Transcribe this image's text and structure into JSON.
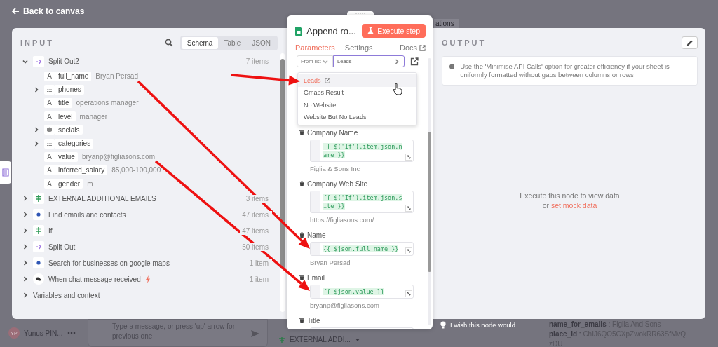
{
  "back_button": {
    "label": "Back to canvas"
  },
  "background": {
    "tab_fragment": "ations",
    "user": {
      "initials": "YP",
      "name": "Yunus PIN..."
    },
    "chat": {
      "placeholder": "Type a message, or press 'up' arrow for previous one"
    },
    "node_chip": {
      "label": "EXTERNAL ADDI..."
    },
    "fields": [
      {
        "key": "name_for_emails",
        "separator": ":",
        "value": "Figlia And Sons"
      },
      {
        "key": "place_id",
        "separator": ":",
        "value": "ChIJ6QO5CXpZwokRR63SfMvQzDU"
      }
    ]
  },
  "input": {
    "title": "INPUT",
    "view_tabs": [
      {
        "label": "Schema",
        "selected": true
      },
      {
        "label": "Table",
        "selected": false
      },
      {
        "label": "JSON",
        "selected": false
      }
    ],
    "nodes": [
      {
        "name": "Split Out2",
        "kind": "split",
        "count": "7 items",
        "expanded": true,
        "trigger": false,
        "fields": [
          {
            "kind": "string",
            "type_label": "A",
            "key": "full_name",
            "value": "Bryan Persad"
          },
          {
            "kind": "array",
            "key": "phones"
          },
          {
            "kind": "string",
            "type_label": "A",
            "key": "title",
            "value": "operations manager"
          },
          {
            "kind": "string",
            "type_label": "A",
            "key": "level",
            "value": "manager"
          },
          {
            "kind": "object",
            "key": "socials"
          },
          {
            "kind": "array",
            "key": "categories"
          },
          {
            "kind": "string",
            "type_label": "A",
            "key": "value",
            "value": "bryanp@figliasons.com"
          },
          {
            "kind": "string",
            "type_label": "A",
            "key": "inferred_salary",
            "value": "85,000-100,000"
          },
          {
            "kind": "string",
            "type_label": "A",
            "key": "gender",
            "value": "m"
          }
        ]
      },
      {
        "name": "EXTERNAL ADDITIONAL EMAILS",
        "kind": "if",
        "count": "3 items",
        "expanded": false,
        "trigger": false
      },
      {
        "name": "Find emails and contacts",
        "kind": "http",
        "count": "47 items",
        "expanded": false,
        "trigger": false
      },
      {
        "name": "If",
        "kind": "if",
        "count": "47 items",
        "expanded": false,
        "trigger": false
      },
      {
        "name": "Split Out",
        "kind": "split",
        "count": "50 items",
        "expanded": false,
        "trigger": false
      },
      {
        "name": "Search for businesses on google maps",
        "kind": "http",
        "count": "1 item",
        "expanded": false,
        "trigger": false
      },
      {
        "name": "When chat message received",
        "kind": "chat",
        "count": "1 item",
        "expanded": false,
        "trigger": true
      }
    ],
    "variables": {
      "label": "Variables and context",
      "expanded": false
    }
  },
  "node": {
    "title": "Append ro...",
    "execute_button": "Execute step",
    "tabs": [
      {
        "label": "Parameters",
        "selected": true,
        "external": false
      },
      {
        "label": "Settings",
        "selected": false,
        "external": false
      },
      {
        "label": "Docs",
        "selected": false,
        "external": true
      }
    ],
    "document": {
      "mode": "From list",
      "value": "Leads",
      "expanded": true
    },
    "sheet_options": [
      {
        "label": "Leads",
        "selected": true
      },
      {
        "label": "Gmaps Result",
        "selected": false
      },
      {
        "label": "No Website",
        "selected": false
      },
      {
        "label": "Website But No Leads",
        "selected": false
      }
    ],
    "fields": [
      {
        "label": "Company Name",
        "expression": "{{ $('If').item.json.name }}",
        "preview": "Figlia & Sons Inc"
      },
      {
        "label": "Company Web Site",
        "expression": "{{ $('If').item.json.site }}",
        "preview": "https://figliasons.com/"
      },
      {
        "label": "Name",
        "expression": "{{ $json.full_name }}",
        "preview": "Bryan Persad"
      },
      {
        "label": "Email",
        "expression": "{{ $json.value }}",
        "preview": "bryanp@figliasons.com"
      },
      {
        "label": "Title"
      }
    ]
  },
  "output": {
    "title": "OUTPUT",
    "notice": "Use the 'Minimise API Calls' option for greater efficiency if your sheet is uniformly formatted without gaps between columns or rows",
    "empty_message": "Execute this node to view data",
    "empty_or": "or",
    "mock_link": "set mock data"
  },
  "feedback": {
    "label": "I wish this node would..."
  }
}
